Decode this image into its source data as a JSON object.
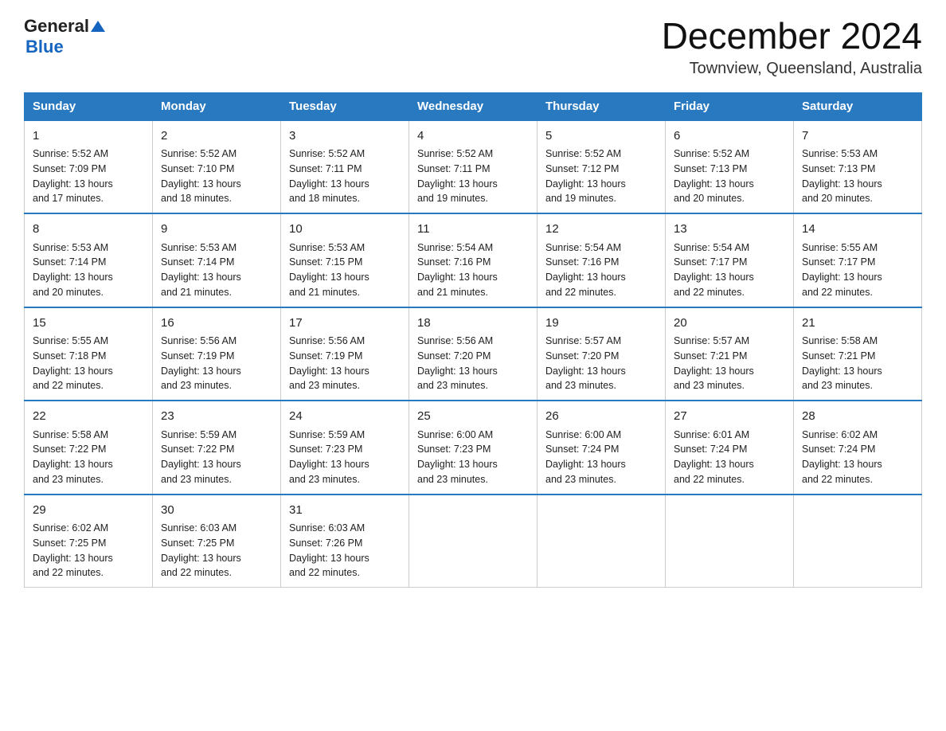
{
  "logo": {
    "text_general": "General",
    "text_blue": "Blue"
  },
  "header": {
    "month_year": "December 2024",
    "location": "Townview, Queensland, Australia"
  },
  "days_of_week": [
    "Sunday",
    "Monday",
    "Tuesday",
    "Wednesday",
    "Thursday",
    "Friday",
    "Saturday"
  ],
  "weeks": [
    [
      {
        "day": "1",
        "info": "Sunrise: 5:52 AM\nSunset: 7:09 PM\nDaylight: 13 hours\nand 17 minutes."
      },
      {
        "day": "2",
        "info": "Sunrise: 5:52 AM\nSunset: 7:10 PM\nDaylight: 13 hours\nand 18 minutes."
      },
      {
        "day": "3",
        "info": "Sunrise: 5:52 AM\nSunset: 7:11 PM\nDaylight: 13 hours\nand 18 minutes."
      },
      {
        "day": "4",
        "info": "Sunrise: 5:52 AM\nSunset: 7:11 PM\nDaylight: 13 hours\nand 19 minutes."
      },
      {
        "day": "5",
        "info": "Sunrise: 5:52 AM\nSunset: 7:12 PM\nDaylight: 13 hours\nand 19 minutes."
      },
      {
        "day": "6",
        "info": "Sunrise: 5:52 AM\nSunset: 7:13 PM\nDaylight: 13 hours\nand 20 minutes."
      },
      {
        "day": "7",
        "info": "Sunrise: 5:53 AM\nSunset: 7:13 PM\nDaylight: 13 hours\nand 20 minutes."
      }
    ],
    [
      {
        "day": "8",
        "info": "Sunrise: 5:53 AM\nSunset: 7:14 PM\nDaylight: 13 hours\nand 20 minutes."
      },
      {
        "day": "9",
        "info": "Sunrise: 5:53 AM\nSunset: 7:14 PM\nDaylight: 13 hours\nand 21 minutes."
      },
      {
        "day": "10",
        "info": "Sunrise: 5:53 AM\nSunset: 7:15 PM\nDaylight: 13 hours\nand 21 minutes."
      },
      {
        "day": "11",
        "info": "Sunrise: 5:54 AM\nSunset: 7:16 PM\nDaylight: 13 hours\nand 21 minutes."
      },
      {
        "day": "12",
        "info": "Sunrise: 5:54 AM\nSunset: 7:16 PM\nDaylight: 13 hours\nand 22 minutes."
      },
      {
        "day": "13",
        "info": "Sunrise: 5:54 AM\nSunset: 7:17 PM\nDaylight: 13 hours\nand 22 minutes."
      },
      {
        "day": "14",
        "info": "Sunrise: 5:55 AM\nSunset: 7:17 PM\nDaylight: 13 hours\nand 22 minutes."
      }
    ],
    [
      {
        "day": "15",
        "info": "Sunrise: 5:55 AM\nSunset: 7:18 PM\nDaylight: 13 hours\nand 22 minutes."
      },
      {
        "day": "16",
        "info": "Sunrise: 5:56 AM\nSunset: 7:19 PM\nDaylight: 13 hours\nand 23 minutes."
      },
      {
        "day": "17",
        "info": "Sunrise: 5:56 AM\nSunset: 7:19 PM\nDaylight: 13 hours\nand 23 minutes."
      },
      {
        "day": "18",
        "info": "Sunrise: 5:56 AM\nSunset: 7:20 PM\nDaylight: 13 hours\nand 23 minutes."
      },
      {
        "day": "19",
        "info": "Sunrise: 5:57 AM\nSunset: 7:20 PM\nDaylight: 13 hours\nand 23 minutes."
      },
      {
        "day": "20",
        "info": "Sunrise: 5:57 AM\nSunset: 7:21 PM\nDaylight: 13 hours\nand 23 minutes."
      },
      {
        "day": "21",
        "info": "Sunrise: 5:58 AM\nSunset: 7:21 PM\nDaylight: 13 hours\nand 23 minutes."
      }
    ],
    [
      {
        "day": "22",
        "info": "Sunrise: 5:58 AM\nSunset: 7:22 PM\nDaylight: 13 hours\nand 23 minutes."
      },
      {
        "day": "23",
        "info": "Sunrise: 5:59 AM\nSunset: 7:22 PM\nDaylight: 13 hours\nand 23 minutes."
      },
      {
        "day": "24",
        "info": "Sunrise: 5:59 AM\nSunset: 7:23 PM\nDaylight: 13 hours\nand 23 minutes."
      },
      {
        "day": "25",
        "info": "Sunrise: 6:00 AM\nSunset: 7:23 PM\nDaylight: 13 hours\nand 23 minutes."
      },
      {
        "day": "26",
        "info": "Sunrise: 6:00 AM\nSunset: 7:24 PM\nDaylight: 13 hours\nand 23 minutes."
      },
      {
        "day": "27",
        "info": "Sunrise: 6:01 AM\nSunset: 7:24 PM\nDaylight: 13 hours\nand 22 minutes."
      },
      {
        "day": "28",
        "info": "Sunrise: 6:02 AM\nSunset: 7:24 PM\nDaylight: 13 hours\nand 22 minutes."
      }
    ],
    [
      {
        "day": "29",
        "info": "Sunrise: 6:02 AM\nSunset: 7:25 PM\nDaylight: 13 hours\nand 22 minutes."
      },
      {
        "day": "30",
        "info": "Sunrise: 6:03 AM\nSunset: 7:25 PM\nDaylight: 13 hours\nand 22 minutes."
      },
      {
        "day": "31",
        "info": "Sunrise: 6:03 AM\nSunset: 7:26 PM\nDaylight: 13 hours\nand 22 minutes."
      },
      {
        "day": "",
        "info": ""
      },
      {
        "day": "",
        "info": ""
      },
      {
        "day": "",
        "info": ""
      },
      {
        "day": "",
        "info": ""
      }
    ]
  ]
}
